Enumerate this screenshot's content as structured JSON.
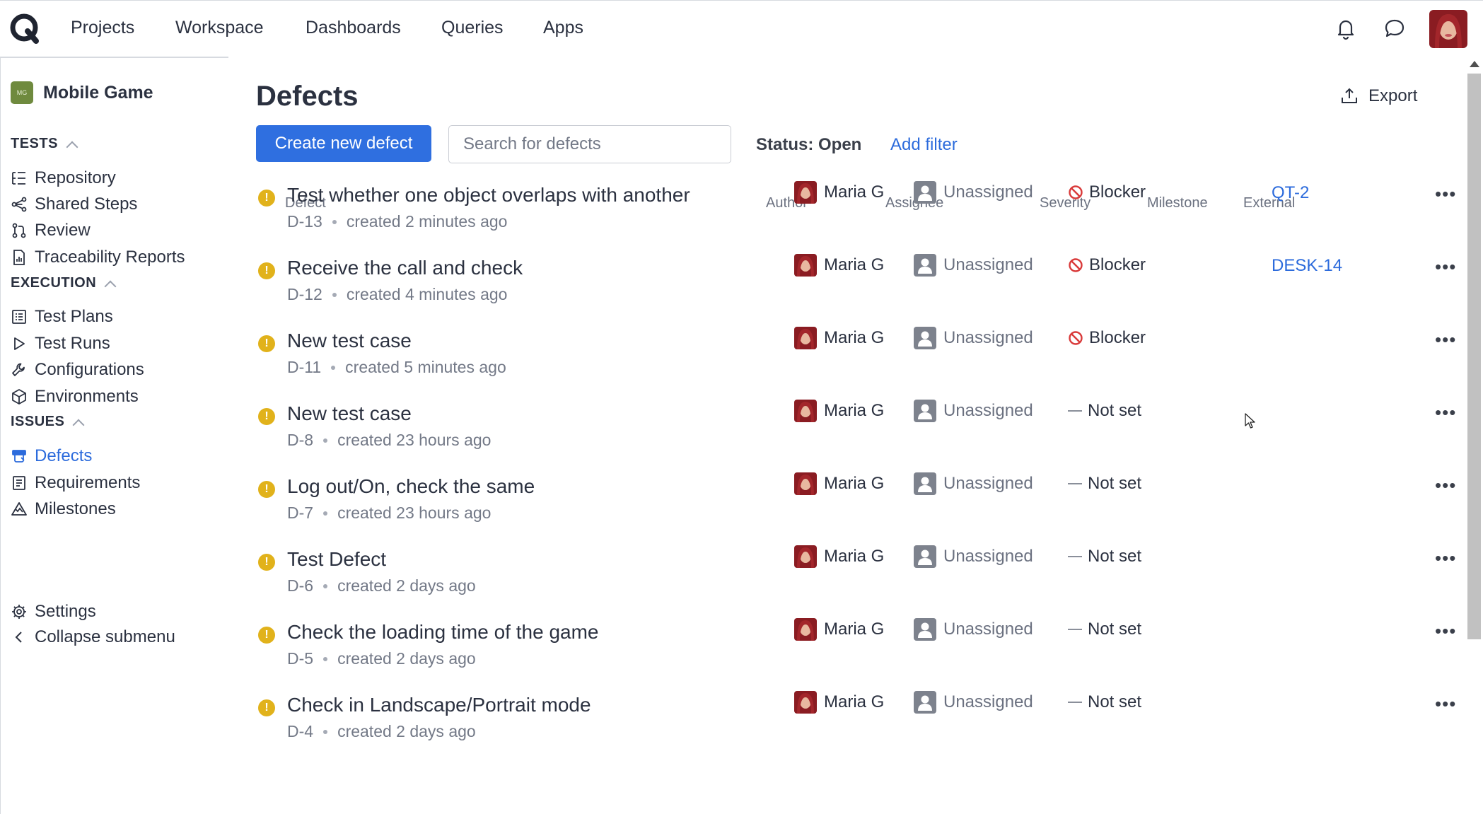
{
  "topnav": {
    "items": [
      "Projects",
      "Workspace",
      "Dashboards",
      "Queries",
      "Apps"
    ],
    "icons": [
      "bell-icon",
      "chat-icon"
    ]
  },
  "sidebar": {
    "project_badge": "MG",
    "project_name": "Mobile Game",
    "sections": {
      "tests": "TESTS",
      "execution": "EXECUTION",
      "issues": "ISSUES"
    },
    "tests_items": [
      "Repository",
      "Shared Steps",
      "Review",
      "Traceability Reports"
    ],
    "execution_items": [
      "Test Plans",
      "Test Runs",
      "Configurations",
      "Environments"
    ],
    "issues_items": [
      "Defects",
      "Requirements",
      "Milestones"
    ],
    "settings": "Settings",
    "collapse": "Collapse submenu",
    "active_item": "Defects"
  },
  "main": {
    "title": "Defects",
    "export_label": "Export",
    "create_button": "Create new defect",
    "search_placeholder": "Search for defects",
    "status_filter": "Status: Open",
    "add_filter": "Add filter",
    "columns": {
      "defect": "Defect",
      "author": "Author",
      "assignee": "Assignee",
      "severity": "Severity",
      "milestone": "Milestone",
      "external": "External"
    }
  },
  "defects": [
    {
      "title": "Test whether one object overlaps with another",
      "id": "D-13",
      "created": "created 2 minutes ago",
      "author": "Maria G",
      "assignee": "Unassigned",
      "severity": "Blocker",
      "external": "QT-2"
    },
    {
      "title": "Receive the call and check",
      "id": "D-12",
      "created": "created 4 minutes ago",
      "author": "Maria G",
      "assignee": "Unassigned",
      "severity": "Blocker",
      "external": "DESK-14"
    },
    {
      "title": "New test case",
      "id": "D-11",
      "created": "created 5 minutes ago",
      "author": "Maria G",
      "assignee": "Unassigned",
      "severity": "Blocker",
      "external": ""
    },
    {
      "title": "New test case",
      "id": "D-8",
      "created": "created 23 hours ago",
      "author": "Maria G",
      "assignee": "Unassigned",
      "severity": "Not set",
      "external": ""
    },
    {
      "title": "Log out/On, check the same",
      "id": "D-7",
      "created": "created 23 hours ago",
      "author": "Maria G",
      "assignee": "Unassigned",
      "severity": "Not set",
      "external": ""
    },
    {
      "title": "Test Defect",
      "id": "D-6",
      "created": "created 2 days ago",
      "author": "Maria G",
      "assignee": "Unassigned",
      "severity": "Not set",
      "external": ""
    },
    {
      "title": "Check the loading time of the game",
      "id": "D-5",
      "created": "created 2 days ago",
      "author": "Maria G",
      "assignee": "Unassigned",
      "severity": "Not set",
      "external": ""
    },
    {
      "title": "Check in Landscape/Portrait mode",
      "id": "D-4",
      "created": "created 2 days ago",
      "author": "Maria G",
      "assignee": "Unassigned",
      "severity": "Not set",
      "external": ""
    }
  ],
  "colors": {
    "accent": "#2f6fe0",
    "link": "#2c6bdc",
    "status_open": "#e1b21b",
    "blocker": "#d93a3a"
  }
}
